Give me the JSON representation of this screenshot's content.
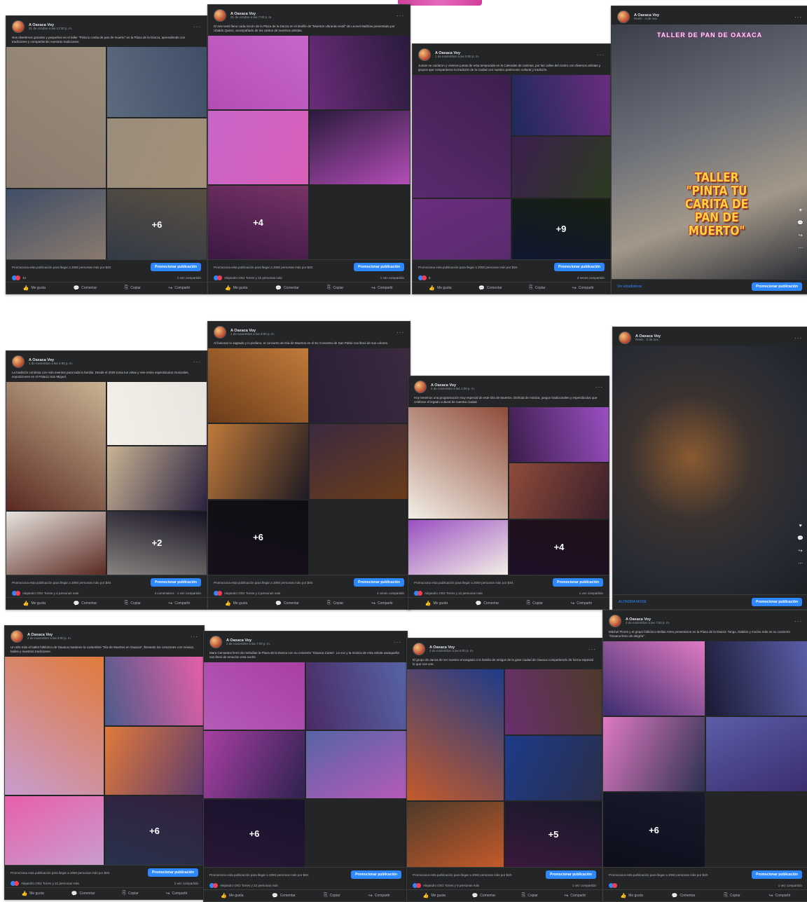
{
  "page": {
    "accent": "#c81d8a",
    "background": "#ffffff"
  },
  "common": {
    "author": "A Oaxaca Voy",
    "like_label": "Me gusta",
    "comment_label": "Comentar",
    "share_label": "Compartir",
    "copy_label": "Copiar",
    "promote_label": "Promocionar publicación",
    "promo_text": "Promociona esta publicación para llegar a 2050 personas más por $40."
  },
  "posts": [
    {
      "date": "31 de octubre a las 12:00 p. m.",
      "caption": "Nos divertimos grandes y pequeños en el taller \"Pinta tu carita de pan de muerto\" en la Plaza de la Danza, aprendiendo con tradiciones y compartiendo nuestras tradiciones.",
      "photo_count": "+6",
      "stats_left": "10",
      "stats_right": "1 vez compartido",
      "colors": [
        "#8a7a6e",
        "#5d6b80",
        "#9a8d7b",
        "#3f4d66",
        "#a39078"
      ]
    },
    {
      "date": "31 de octubre a las 7:00 p. m.",
      "caption": "El arte textil lleno cada rincón de la Plaza de la Danza en el desfile de \"Muertos vibrando textil\" de Leonel Mathías presentado por Ubaldo Quiroz, acompañado de los cantos de nuestros artistas.",
      "photo_count": "+4",
      "stats_left": "Alejandro Ortiz Torres y 22 personas más",
      "stats_right": "1 vez compartido",
      "colors": [
        "#b34db6",
        "#6b2c7a",
        "#c766c9",
        "#2a1b3d",
        "#d95fb8"
      ]
    },
    {
      "date": "1 de noviembre a las 9:00 p. m.",
      "caption": "Juntas se cuidaron y vivieron juntas de esta temporada en la Calendas de catrinas, por las calles del centro con diversos artistas y grupos que compartieron la tradición de la ciudad con nuestro patrimonio cultural y tradición.",
      "photo_count": "+9",
      "stats_left": "6",
      "stats_right": "2 veces compartido",
      "colors": [
        "#5a2b6e",
        "#1d2a5a",
        "#3d1f4f",
        "#6b2d7d",
        "#2b3b1f"
      ]
    },
    {
      "date": "Reels · 4 de nov.",
      "reel_title": "TALLER DE PAN DE OAXACA",
      "reel_text": "TALLER \"PINTA TU CARITA DE PAN DE MUERTO\"",
      "footer_left": "Ver estadísticas"
    },
    {
      "date": "1 de noviembre a las 4:00 p. m.",
      "caption": "La tradición continúa con más eventos para toda la familia. Desde el 2026 toma tus velas y vive estos espectáculos musicales, exposiciones en el Palacio San Miguel.",
      "photo_count": "+2",
      "stats_left": "Alejandro Ortiz Torres y 4 personas más",
      "stats_right": "3 comentarios · 1 vez compartido",
      "colors": [
        "#5b2a22",
        "#f4efe8",
        "#c9b494",
        "#e8e4df",
        "#2a2140"
      ]
    },
    {
      "date": "1 de noviembre a las 9:00 p. m.",
      "caption": "Al fusionar lo sagrado y lo profano, el concierto de Día de Muertos en el Ex Convento de San Pablo nos llenó de sus colores.",
      "photo_count": "+6",
      "stats_left": "Alejandro Ortiz Torres y 3 personas más",
      "stats_right": "4 veces compartido",
      "colors": [
        "#6b3c1a",
        "#2a1e35",
        "#c17a3a",
        "#3b2a40",
        "#1d1a22"
      ]
    },
    {
      "date": "2 de noviembre a las 1:00 p. m.",
      "caption": "Hoy tenemos una programación muy especial de este Día de Muertos. Disfruta de música, juegos tradicionales y espectáculos que celebran el legado cultural de nuestra ciudad.",
      "photo_count": "+4",
      "stats_left": "Alejandro Ortiz Torres y 13 personas más",
      "stats_right": "1 vez compartido",
      "colors": [
        "#f3efe6",
        "#3a1d4a",
        "#8e4b3a",
        "#9a4fc2",
        "#3a1f2b"
      ]
    },
    {
      "date": "Reels · 2 de nov.",
      "reel_title": "",
      "reel_text": "",
      "footer_left": "ALONDRA MOSE"
    },
    {
      "date": "2 de noviembre a las 8:00 p. m.",
      "caption": "Un año más el ballet folklórico de Oaxaca mantiene la costumbre \"Día de Muertos en Oaxaca\", llenando los corazones con música, bailes y nuestras tradiciones.",
      "photo_count": "+6",
      "stats_left": "Alejandro Ortiz Torres y 21 personas más",
      "stats_right": "1 vez compartido",
      "colors": [
        "#c89dd0",
        "#4a5b8a",
        "#e07a3a",
        "#e85fa8",
        "#5d3a6e"
      ]
    },
    {
      "date": "2 de noviembre a las 7:00 p. m.",
      "caption": "Mara Cervantes llenó de melodías la Plaza de la Danza con su concierto \"Oaxaca Canta\". La voz y la música de esta artista oaxaqueña nos llenó de emoción esta noche.",
      "photo_count": "+6",
      "stats_left": "Alejandro Ortiz Torres y 22 personas más",
      "stats_right": "",
      "colors": [
        "#b55bb8",
        "#4a2a63",
        "#a93fa3",
        "#5664a6",
        "#2e2250"
      ]
    },
    {
      "date": "2 de noviembre a las 6:00 p. m.",
      "caption": "El grupo de danza de ser nuestro encargado a la familia de amigos de la gran ciudad de Oaxaca compartiendo de forma especial lo que nos une.",
      "photo_count": "+5",
      "stats_left": "Alejandro Ortiz Torres y 8 personas más",
      "stats_right": "1 vez compartido",
      "colors": [
        "#c45a2a",
        "#6a2f6e",
        "#1d3b8a",
        "#4d3a2a",
        "#2a2e4a"
      ]
    },
    {
      "date": "2 de noviembre a las 7:00 p. m.",
      "caption": "Mitchel Flores y el grupo folklórico Bellas Artes presentaron en la Plaza de la Danza: Tango, Diablos y mucho más en su concierto \"Oaxaca lleno de alegría\".",
      "photo_count": "+6",
      "stats_left": "",
      "stats_right": "1 vez compartido",
      "colors": [
        "#3b2d6e",
        "#1a1a33",
        "#e07ac3",
        "#5a5ea8",
        "#2c3150"
      ]
    }
  ]
}
